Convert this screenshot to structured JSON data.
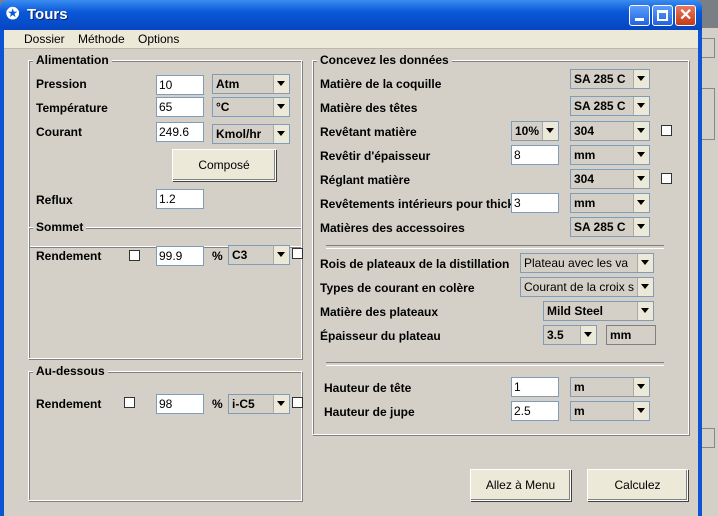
{
  "window": {
    "title": "Tours",
    "icon": "app-logo-icon"
  },
  "menu": [
    "Dossier",
    "Méthode",
    "Options"
  ],
  "alimentation": {
    "title": "Alimentation",
    "pression": {
      "label": "Pression",
      "value": "10",
      "unit": "Atm"
    },
    "temperature": {
      "label": "Température",
      "value": "65",
      "unit": "°C"
    },
    "courant": {
      "label": "Courant",
      "value": "249.6",
      "unit": "Kmol/hr"
    },
    "compose_button": "Composé",
    "reflux": {
      "label": "Reflux",
      "value": "1.2"
    }
  },
  "sommet": {
    "title": "Sommet",
    "label": "Rendement",
    "value": "99.9",
    "pct": "%",
    "component": "C3"
  },
  "audessous": {
    "title": "Au-dessous",
    "label": "Rendement",
    "value": "98",
    "pct": "%",
    "component": "i-C5"
  },
  "donnees": {
    "title": "Concevez les données",
    "coquille": {
      "label": "Matière de la coquille",
      "value": "SA 285 C"
    },
    "tetes": {
      "label": "Matière des têtes",
      "value": "SA 285 C"
    },
    "revetant": {
      "label": "Revêtant matière",
      "pct": "10%",
      "value": "304"
    },
    "revetir": {
      "label": "Revêtir d'épaisseur",
      "value": "8",
      "unit": "mm"
    },
    "reglant": {
      "label": "Réglant matière",
      "value": "304"
    },
    "interieurs": {
      "label": "Revêtements intérieurs pour thick",
      "value": "3",
      "unit": "mm"
    },
    "accessoires": {
      "label": "Matières des accessoires",
      "value": "SA 285 C"
    },
    "rois": {
      "label": "Rois de plateaux de la distillation",
      "value": "Plateau avec les va"
    },
    "types": {
      "label": "Types de courant en colère",
      "value": "Courant de la croix s"
    },
    "plateaux": {
      "label": "Matière des plateaux",
      "value": "Mild Steel"
    },
    "epaisseur": {
      "label": "Épaisseur du plateau",
      "value": "3.5",
      "unit": "mm"
    },
    "tete": {
      "label": "Hauteur de tête",
      "value": "1",
      "unit": "m"
    },
    "jupe": {
      "label": "Hauteur de jupe",
      "value": "2.5",
      "unit": "m"
    }
  },
  "buttons": {
    "menu": "Allez à Menu",
    "calc": "Calculez"
  },
  "background": {
    "frag1": "D",
    "frag2": "Re"
  }
}
